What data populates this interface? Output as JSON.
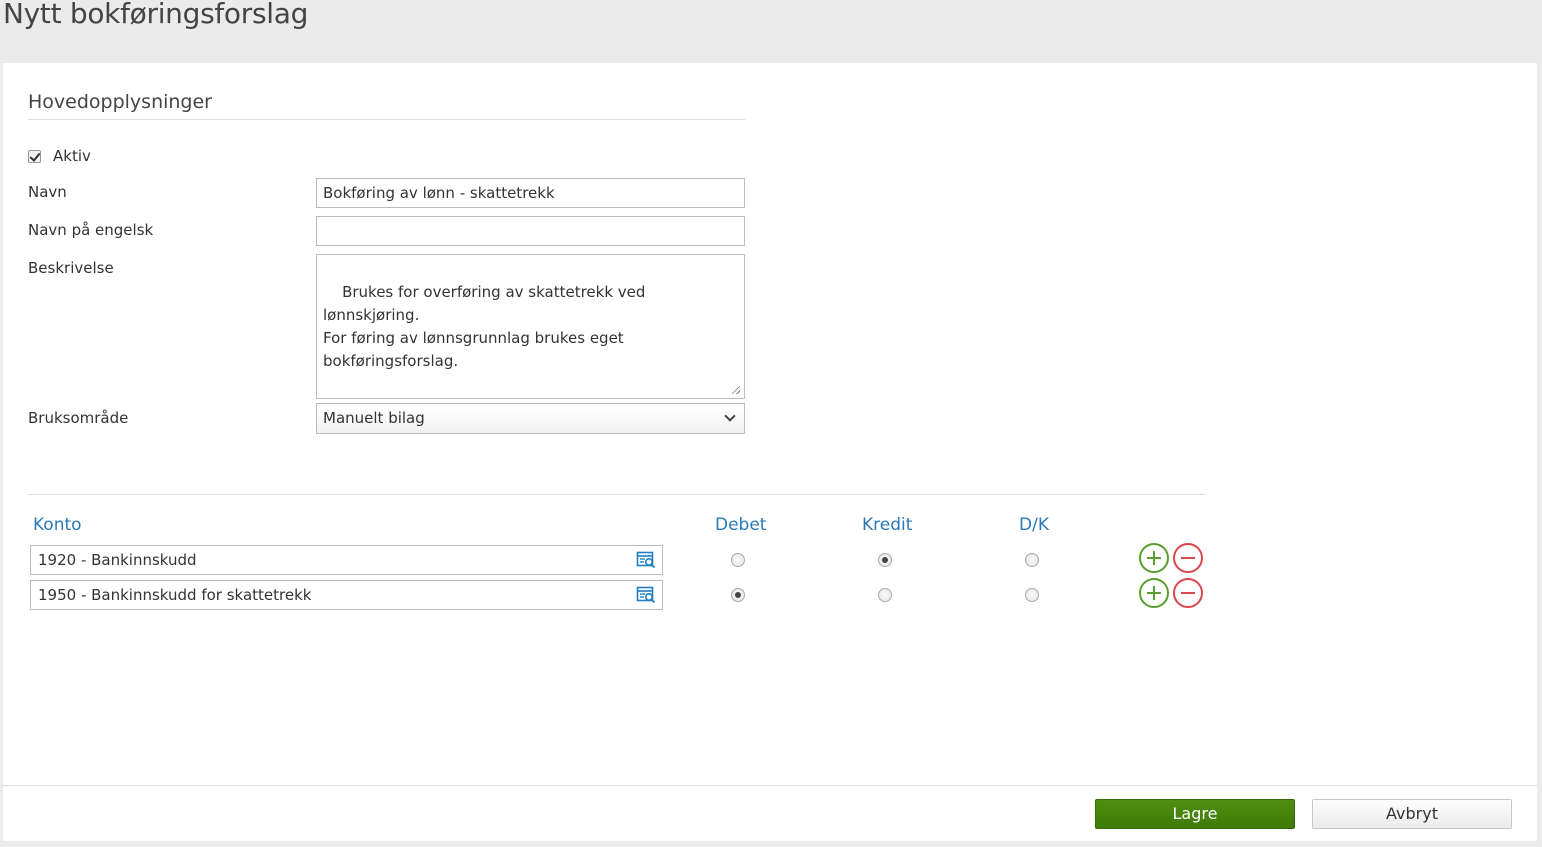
{
  "page": {
    "title": "Nytt bokføringsforslag"
  },
  "main": {
    "section_title": "Hovedopplysninger",
    "aktiv": {
      "label": "Aktiv",
      "checked": true
    },
    "navn": {
      "label": "Navn",
      "value": "Bokføring av lønn - skattetrekk"
    },
    "navn_engelsk": {
      "label": "Navn på engelsk",
      "value": ""
    },
    "beskrivelse": {
      "label": "Beskrivelse",
      "value": "Brukes for overføring av skattetrekk ved lønnskjøring.\nFor føring av lønnsgrunnlag brukes eget\nbokføringsforslag."
    },
    "bruksomrade": {
      "label": "Bruksområde",
      "selected": "Manuelt bilag"
    }
  },
  "table": {
    "headers": {
      "konto": "Konto",
      "debet": "Debet",
      "kredit": "Kredit",
      "dk": "D/K"
    },
    "rows": [
      {
        "konto": "1920 - Bankinnskudd",
        "selected": "kredit"
      },
      {
        "konto": "1950 - Bankinnskudd for skattetrekk",
        "selected": "debet"
      }
    ]
  },
  "footer": {
    "save_label": "Lagre",
    "cancel_label": "Avbryt"
  },
  "colors": {
    "accent": "#2a7ab8",
    "save": "#3f7a07",
    "add": "#5a9e2f",
    "remove": "#d9464d"
  }
}
